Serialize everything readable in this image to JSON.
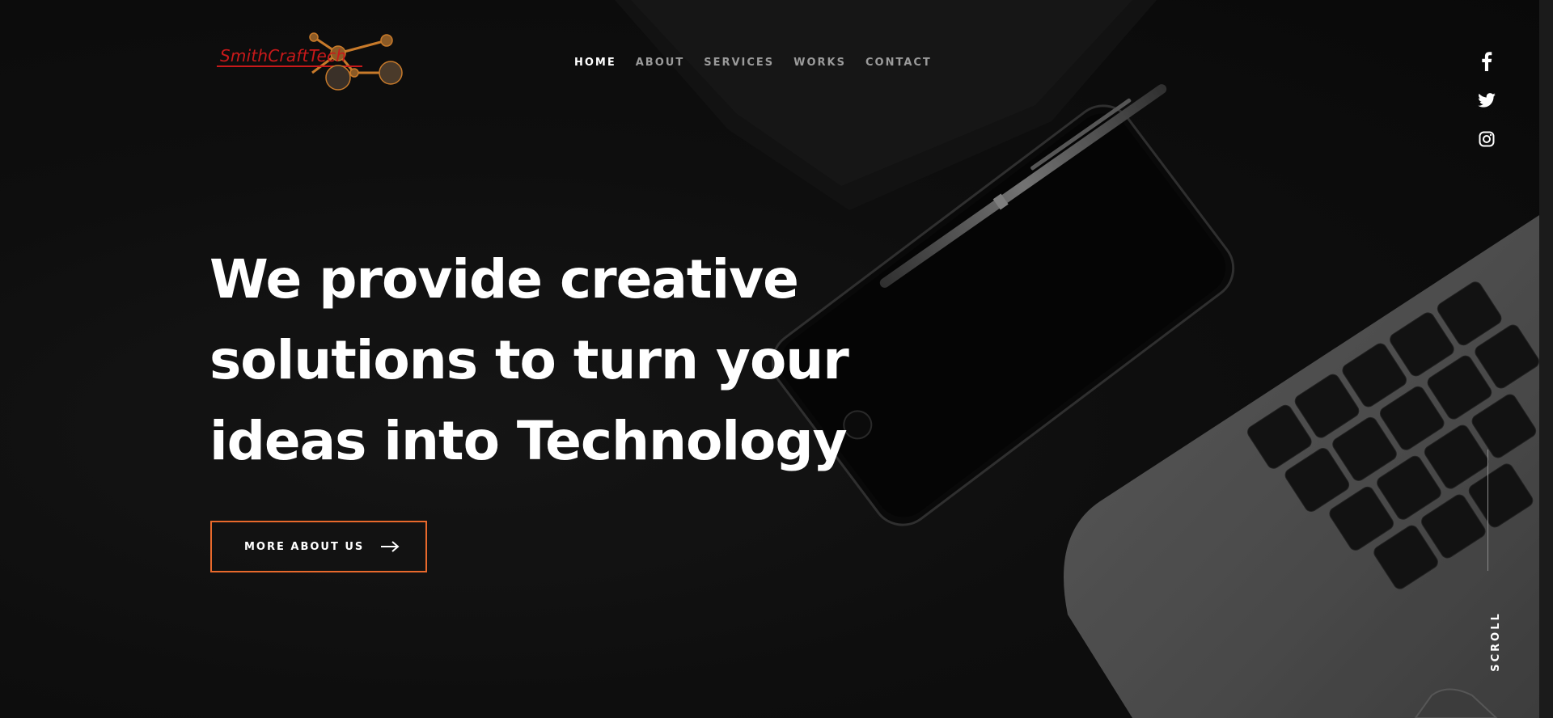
{
  "brand": {
    "logo_text": "SmithCraftTech",
    "logo_color": "#c8191a",
    "accent_color": "#e8692c"
  },
  "nav": {
    "items": [
      {
        "label": "HOME",
        "active": true
      },
      {
        "label": "ABOUT",
        "active": false
      },
      {
        "label": "SERVICES",
        "active": false
      },
      {
        "label": "WORKS",
        "active": false
      },
      {
        "label": "CONTACT",
        "active": false
      }
    ]
  },
  "social": {
    "icons": [
      "facebook-icon",
      "twitter-icon",
      "instagram-icon"
    ]
  },
  "hero": {
    "headline_lines": [
      "We provide creative",
      "solutions to turn your",
      "ideas into Technology"
    ],
    "cta_label": "MORE ABOUT US",
    "cta_icon": "arrow-right-icon"
  },
  "scroll": {
    "label": "SCROLL"
  }
}
